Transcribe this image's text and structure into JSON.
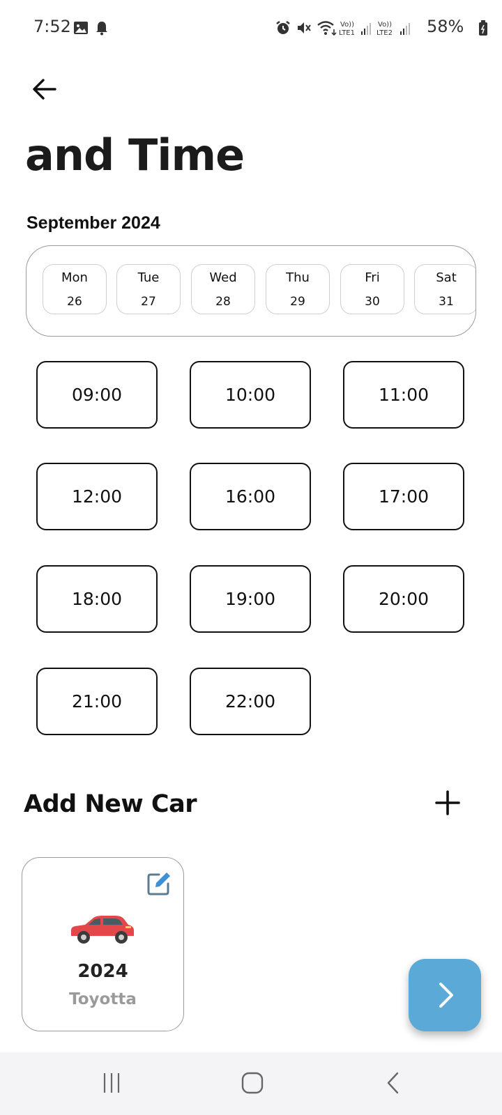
{
  "status_bar": {
    "time": "7:52",
    "battery": "58%",
    "left_icons": [
      "gallery-icon",
      "bell-icon"
    ],
    "right_icons": [
      "alarm-icon",
      "mute-icon",
      "wifi-icon",
      "volte-lte1-signal-icon",
      "volte-lte2-signal-icon",
      "battery-icon"
    ],
    "lte1_label": "LTE1",
    "lte2_label": "LTE2",
    "vo_label": "Vo))"
  },
  "header": {
    "title": "and Time"
  },
  "calendar": {
    "month_label": "September 2024",
    "days": [
      {
        "name": "Mon",
        "num": "26"
      },
      {
        "name": "Tue",
        "num": "27"
      },
      {
        "name": "Wed",
        "num": "28"
      },
      {
        "name": "Thu",
        "num": "29"
      },
      {
        "name": "Fri",
        "num": "30"
      },
      {
        "name": "Sat",
        "num": "31"
      }
    ]
  },
  "time_slots": [
    "09:00",
    "10:00",
    "11:00",
    "12:00",
    "16:00",
    "17:00",
    "18:00",
    "19:00",
    "20:00",
    "21:00",
    "22:00"
  ],
  "cars_section": {
    "title": "Add New Car",
    "add_icon": "plus-icon",
    "cars": [
      {
        "year": "2024",
        "make": "Toyotta",
        "car_color": "#e4474a"
      }
    ]
  },
  "colors": {
    "fab": "#5aa9d6",
    "edit_icon": "#3d8fd6"
  }
}
